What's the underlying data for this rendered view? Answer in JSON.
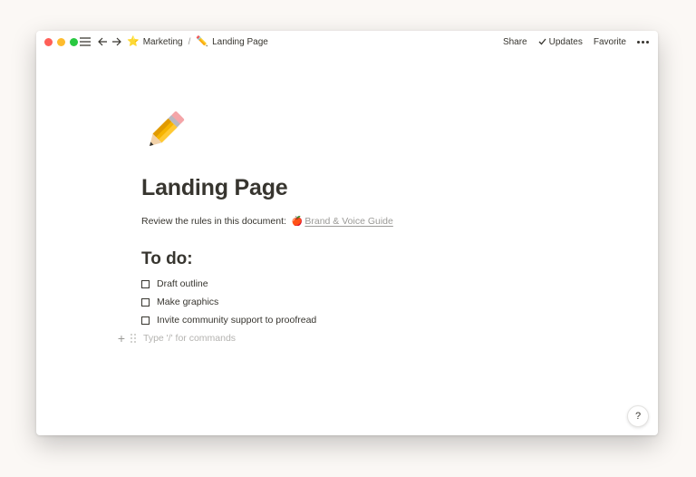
{
  "window": {
    "traffic_lights": [
      "close",
      "minimize",
      "maximize"
    ]
  },
  "topbar": {
    "breadcrumbs": [
      {
        "icon": "⭐️",
        "label": "Marketing"
      },
      {
        "icon": "✏️",
        "label": "Landing Page"
      }
    ],
    "separator": "/",
    "actions": {
      "share": "Share",
      "updates": "Updates",
      "favorite": "Favorite"
    }
  },
  "page": {
    "icon": "pencil",
    "title": "Landing Page",
    "intro_text": "Review the rules in this document:",
    "intro_link_icon": "🍎",
    "intro_link": "Brand & Voice Guide",
    "section_heading": "To do:",
    "todos": [
      {
        "label": "Draft outline",
        "checked": false
      },
      {
        "label": "Make graphics",
        "checked": false
      },
      {
        "label": "Invite community support to proofread",
        "checked": false
      }
    ],
    "command_placeholder": "Type '/' for commands"
  },
  "help": {
    "label": "?"
  },
  "colors": {
    "text": "#37352f",
    "muted": "#9b9a97",
    "background": "#fbf8f5"
  }
}
